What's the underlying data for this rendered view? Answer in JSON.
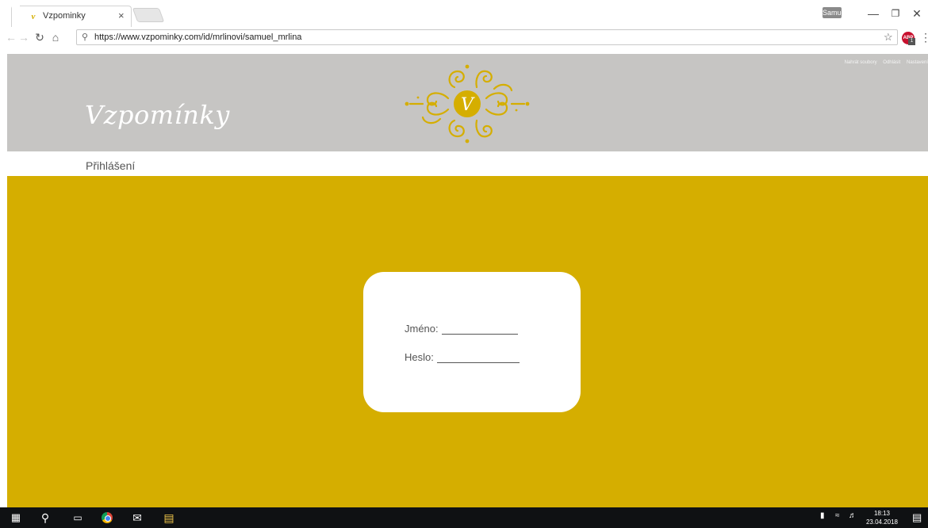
{
  "browser": {
    "tab_title": "Vzpominky",
    "tab_favicon": "v",
    "tab_close": "×",
    "profile": "Samuel",
    "url": "https://www.vzpominky.com/id/mrlinovi/samuel_mrlina",
    "ext_count": "ABP",
    "ext_badge": "1"
  },
  "site": {
    "logo": "Vzpomínky",
    "emblem_letter": "V",
    "top_links": [
      "Nahrát soubory",
      "Odhlásit",
      "Nastavení"
    ],
    "subnav_title": "Přihlášení",
    "login": {
      "name_label": "Jméno:",
      "password_label": "Heslo:"
    }
  },
  "taskbar": {
    "time": "18:13",
    "date": "23.04.2018"
  },
  "colors": {
    "header_gray": "#c6c5c3",
    "accent_gold": "#d5ae00",
    "taskbar": "#0f1113"
  }
}
